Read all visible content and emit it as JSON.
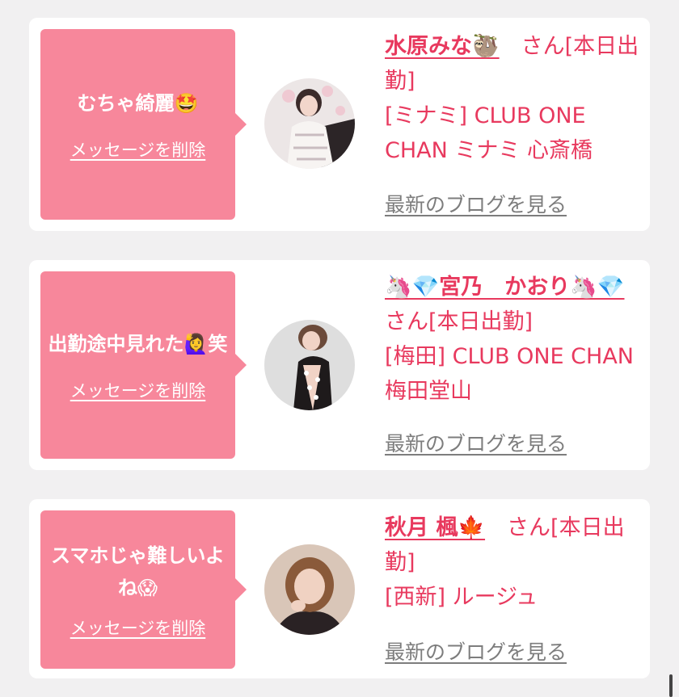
{
  "cards": [
    {
      "message": "むちゃ綺麗🤩",
      "delete_label": "メッセージを削除",
      "name": "水原みな🦥",
      "suffix": "　さん[本日出勤]",
      "shop": "[ミナミ] CLUB ONE CHAN ミナミ 心斎橋",
      "blog_label": "最新のブログを見る"
    },
    {
      "message": "出勤途中見れた🙋‍♀️笑",
      "delete_label": "メッセージを削除",
      "name": "🦄💎宮乃　かおり🦄💎",
      "suffix": "　さん[本日出勤]",
      "shop": "[梅田] CLUB ONE CHAN 梅田堂山",
      "blog_label": "最新のブログを見る"
    },
    {
      "message": "スマホじゃ難しいよね😱",
      "delete_label": "メッセージを削除",
      "name": "秋月 楓🍁",
      "suffix": "　さん[本日出勤]",
      "shop": "[西新] ルージュ",
      "blog_label": "最新のブログを見る"
    }
  ],
  "colors": {
    "accent": "#e8395e",
    "bubble": "#f7879b",
    "background": "#f1f0f1",
    "link_gray": "#7d7d7d"
  }
}
